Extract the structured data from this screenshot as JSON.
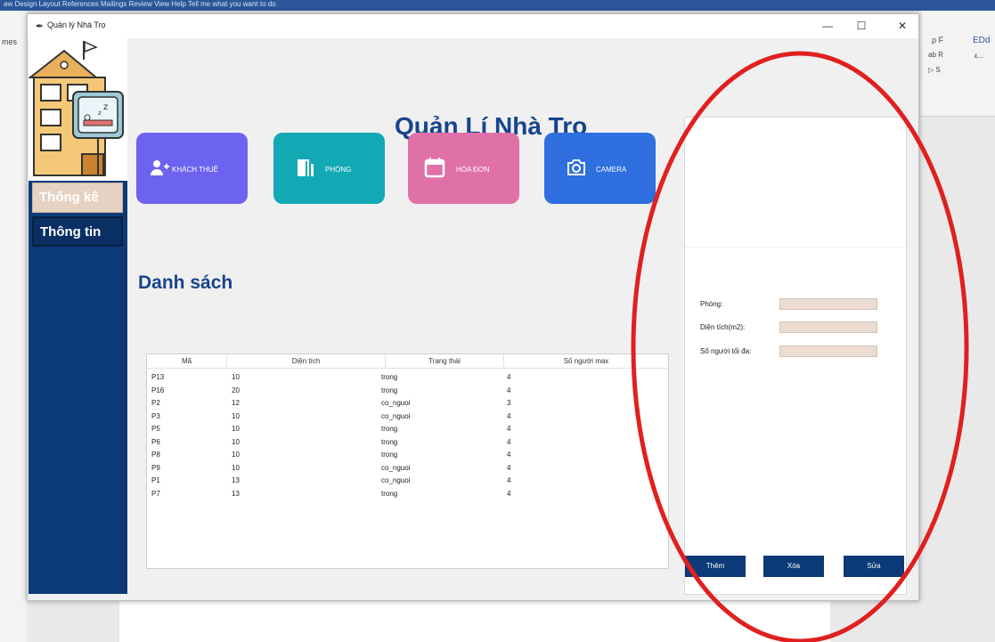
{
  "background_app": {
    "ribbon_text": "aw   Design    Layout    References    Mailings    Review    View    Help    Tell me what you want to do",
    "left_text": "mes",
    "right_items": [
      "ρ F",
      "ab R",
      "▷ S",
      "EDd",
      "ε..."
    ]
  },
  "window": {
    "title": "Quản lý Nhà Trọ",
    "controls": {
      "minimize": "—",
      "maximize": "☐",
      "close": "✕"
    }
  },
  "sidebar": {
    "items": [
      {
        "label": "Thống kê",
        "active": true
      },
      {
        "label": "Thông tin",
        "active": false
      }
    ]
  },
  "header": {
    "title": "Quản Lí Nhà Trọ"
  },
  "tiles": [
    {
      "label": "KHÁCH THUÊ",
      "icon": "add-user-icon",
      "color": "#6c63f0"
    },
    {
      "label": "PHÒNG",
      "icon": "door-icon",
      "color": "#13a9b4"
    },
    {
      "label": "HÓA ĐƠN",
      "icon": "calendar-icon",
      "color": "#e070a8"
    },
    {
      "label": "CAMERA",
      "icon": "camera-icon",
      "color": "#2f6fe0"
    }
  ],
  "list": {
    "title": "Danh sách",
    "columns": [
      "Mã",
      "Diện tích",
      "Trạng thái",
      "Số người max"
    ],
    "rows": [
      [
        "P13",
        "10",
        "trong",
        "4"
      ],
      [
        "P16",
        "20",
        "trong",
        "4"
      ],
      [
        "P2",
        "12",
        "co_nguoi",
        "3"
      ],
      [
        "P3",
        "10",
        "co_nguoi",
        "4"
      ],
      [
        "P5",
        "10",
        "trong",
        "4"
      ],
      [
        "P6",
        "10",
        "trong",
        "4"
      ],
      [
        "P8",
        "10",
        "trong",
        "4"
      ],
      [
        "P9",
        "10",
        "co_nguoi",
        "4"
      ],
      [
        "P1",
        "13",
        "co_nguoi",
        "4"
      ],
      [
        "P7",
        "13",
        "trong",
        "4"
      ]
    ]
  },
  "form": {
    "fields": [
      {
        "label": "Phòng:",
        "value": ""
      },
      {
        "label": "Diện tích(m2):",
        "value": ""
      },
      {
        "label": "Số người tối đa:",
        "value": ""
      }
    ],
    "buttons": {
      "add": "Thêm",
      "delete": "Xóa",
      "edit": "Sửa"
    }
  },
  "annotation": {
    "color": "#e02020"
  }
}
